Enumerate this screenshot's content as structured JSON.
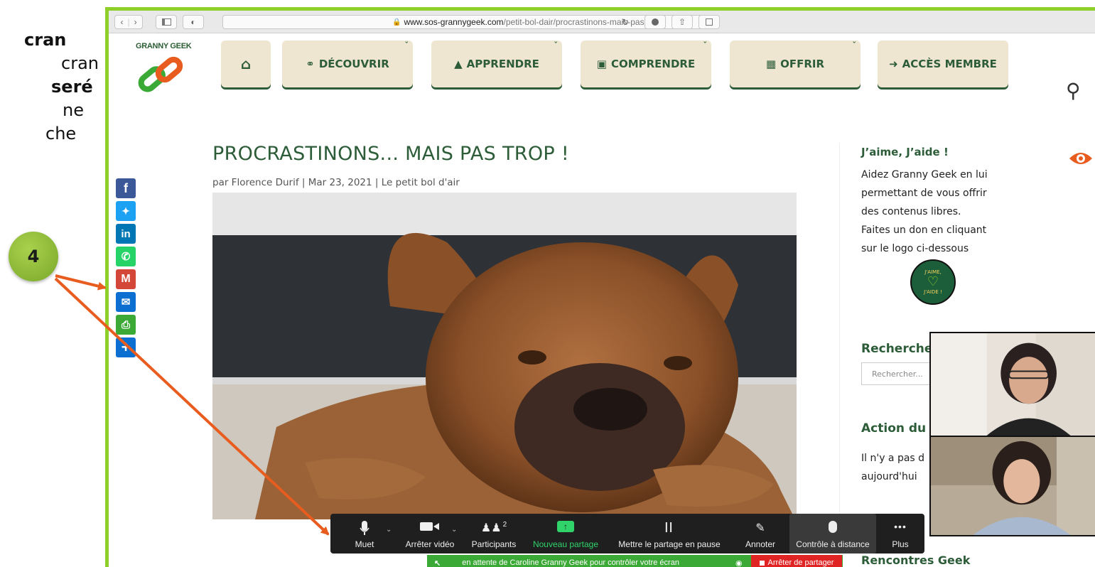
{
  "left_text": [
    "cran",
    "cran",
    "seré",
    "ne",
    "",
    "che"
  ],
  "badge": "4",
  "browser": {
    "url_domain": "www.sos-grannygeek.com",
    "url_path": "/petit-bol-dair/procrastinons-mais-pas-trop/"
  },
  "site": {
    "logo_text": "GRANNY GEEK",
    "nav": [
      "DÉCOUVRIR",
      "APPRENDRE",
      "COMPRENDRE",
      "OFFRIR",
      "ACCÈS MEMBRE"
    ]
  },
  "article": {
    "title": "PROCRASTINONS... MAIS PAS TROP !",
    "meta": "par Florence Durif | Mar 23, 2021 | Le petit bol d'air"
  },
  "sidebar": {
    "jaime_title": "J’aime, J’aide !",
    "jaime_lines": [
      "Aidez Granny Geek en lui",
      "permettant de vous offrir",
      "des contenus libres.",
      "Faites un don en cliquant",
      "sur le logo ci-dessous"
    ],
    "donate_logo_top": "J'AIME,",
    "donate_logo_bottom": "J'AIDE !",
    "search_title": "Recherche",
    "search_placeholder": "Rechercher...",
    "action_title": "Action du",
    "action_lines": [
      "Il n'y a pas d",
      "aujourd'hui"
    ],
    "rencontres_title": "Rencontres Geek"
  },
  "zoom": {
    "mute": "Muet",
    "stop_video": "Arrêter vidéo",
    "participants": "Participants",
    "participants_count": "2",
    "new_share": "Nouveau partage",
    "pause_share": "Mettre le partage en pause",
    "annotate": "Annoter",
    "remote_control": "Contrôle à distance",
    "more": "Plus",
    "status": "en attente de Caroline Granny Geek pour contrôler votre écran",
    "stop_share": "Arrêter de partager"
  },
  "colors": {
    "brand_green": "#2c5c38",
    "nav_bg": "#efe6d2",
    "frame": "#8fcf2a",
    "arrow": "#e85d1f",
    "zoom_green": "#3aa935"
  }
}
